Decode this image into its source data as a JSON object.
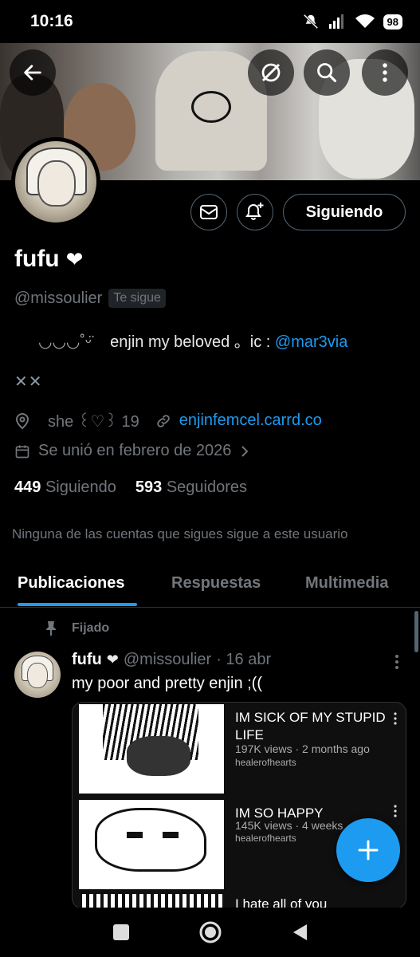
{
  "status_bar": {
    "time": "10:16",
    "battery": "98"
  },
  "header": {
    "back_icon": "arrow-left-icon",
    "grok_icon": "slash-circle-icon",
    "search_icon": "search-icon",
    "more_icon": "more-vertical-icon"
  },
  "profile": {
    "name": "fufu",
    "name_emoji": "❤",
    "handle": "@missoulier",
    "follows_you": "Te sigue",
    "bio_deco": "◡◡◡˚ᵕ̈",
    "bio_text": "enjin my beloved   。ic  :",
    "bio_link": "@mar3via",
    "bio_line2": "✕✕",
    "location": "she  ꒰♡꒱  19",
    "website": "enjinfemcel.carrd.co",
    "joined": "Se unió en febrero de 2026",
    "following_count": "449",
    "following_label": "Siguiendo",
    "followers_count": "593",
    "followers_label": "Seguidores",
    "mutuals_notice": "Ninguna de las cuentas que sigues sigue a este usuario"
  },
  "actions": {
    "follow_button": "Siguiendo",
    "message_icon": "mail-icon",
    "notify_icon": "bell-plus-icon"
  },
  "tabs": [
    {
      "label": "Publicaciones",
      "active": true
    },
    {
      "label": "Respuestas",
      "active": false
    },
    {
      "label": "Multimedia",
      "active": false
    }
  ],
  "pinned_post": {
    "pinned_label": "Fijado",
    "author_name": "fufu",
    "author_emoji": "❤",
    "author_handle": "@missoulier",
    "date": "· 16 abr",
    "text": "my poor and pretty enjin ;((",
    "videos": [
      {
        "title": "IM SICK OF MY STUPID LIFE",
        "meta": "197K views · 2 months ago",
        "channel": "healerofhearts"
      },
      {
        "title": "IM SO HAPPY",
        "meta": "145K views · 4 weeks",
        "channel": "healerofhearts"
      },
      {
        "title": "I hate all of you",
        "meta": "",
        "channel": ""
      }
    ]
  },
  "colors": {
    "accent": "#1d9bf0",
    "muted": "#71767b",
    "background": "#000000"
  }
}
